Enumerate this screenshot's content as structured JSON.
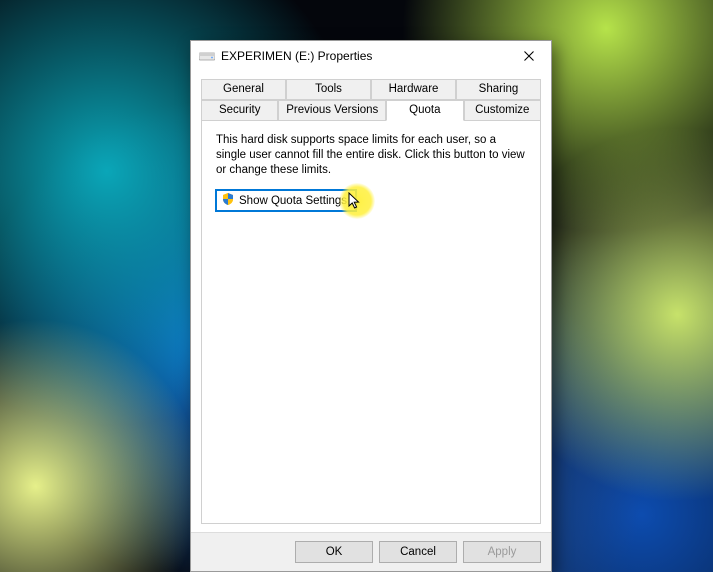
{
  "window": {
    "title": "EXPERIMEN (E:) Properties"
  },
  "tabs": {
    "row1": [
      "General",
      "Tools",
      "Hardware",
      "Sharing"
    ],
    "row2": [
      "Security",
      "Previous Versions",
      "Quota",
      "Customize"
    ],
    "active": "Quota"
  },
  "panel": {
    "description": "This hard disk supports space limits for each user, so a single user cannot fill the entire disk. Click this button to view or change these limits.",
    "button_label": "Show Quota Settings"
  },
  "footer": {
    "ok": "OK",
    "cancel": "Cancel",
    "apply": "Apply"
  }
}
